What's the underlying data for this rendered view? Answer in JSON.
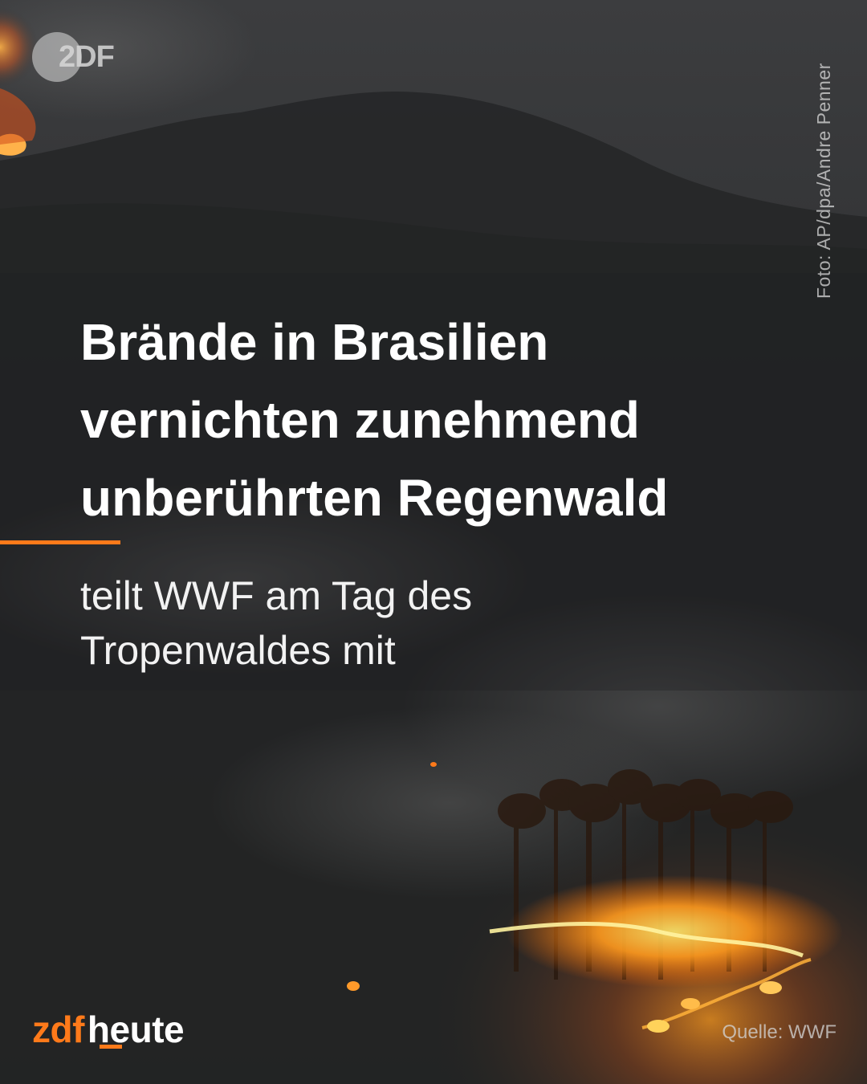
{
  "post": {
    "headline_lines": [
      "Brände in Brasilien",
      "vernichten zunehmend",
      "unberührten Regenwald"
    ],
    "subline_lines": [
      "teilt WWF am Tag des",
      "Tropenwaldes mit"
    ],
    "photo_credit": "Foto: AP/dpa/Andre Penner",
    "source": "Quelle:  WWF"
  },
  "logos": {
    "top_logo_text": "2DF",
    "brand_part_1": "zdf",
    "brand_part_2": "heute"
  },
  "colors": {
    "accent": "#ff7a1a",
    "text": "#ffffff",
    "background": "#2a2b2c"
  },
  "image": {
    "subject": "aerial night photo of forest fire on a hillside",
    "icon": "forest-fire-photo"
  }
}
